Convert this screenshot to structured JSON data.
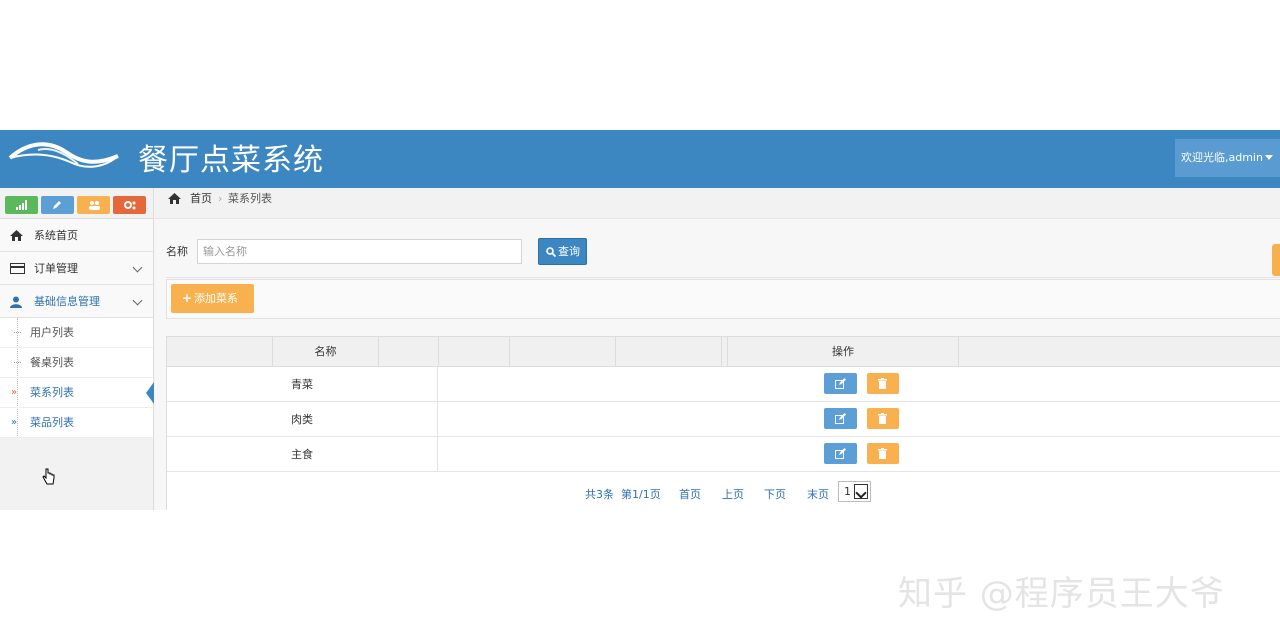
{
  "header": {
    "app_title": "餐厅点菜系统",
    "user_label": "欢迎光临,admin"
  },
  "shortcuts": [
    {
      "icon": "signal-icon",
      "color": "#5cb85c"
    },
    {
      "icon": "pencil-icon",
      "color": "#5b9fd6"
    },
    {
      "icon": "users-icon",
      "color": "#f8b14e"
    },
    {
      "icon": "cogs-icon",
      "color": "#e5683a"
    }
  ],
  "sidebar": {
    "items": [
      {
        "label": "系统首页",
        "icon": "home-icon"
      },
      {
        "label": "订单管理",
        "icon": "credit-card-icon"
      },
      {
        "label": "基础信息管理",
        "icon": "user-icon"
      }
    ],
    "subitems": [
      {
        "label": "用户列表"
      },
      {
        "label": "餐桌列表"
      },
      {
        "label": "菜系列表"
      },
      {
        "label": "菜品列表"
      }
    ]
  },
  "breadcrumb": {
    "home": "首页",
    "current": "菜系列表"
  },
  "search": {
    "label": "名称",
    "placeholder": "输入名称",
    "button": "查询"
  },
  "toolbar": {
    "add_label": "添加菜系"
  },
  "table": {
    "headers": {
      "name": "名称",
      "actions": "操作"
    },
    "rows": [
      {
        "name": "青菜"
      },
      {
        "name": "肉类"
      },
      {
        "name": "主食"
      }
    ]
  },
  "pager": {
    "total": "共3条",
    "page": "第1/1页",
    "first": "首页",
    "prev": "上页",
    "next": "下页",
    "last": "末页",
    "selected": "1"
  },
  "watermark": "知乎 @程序员王大爷",
  "colors": {
    "header": "#3c87c2",
    "primary": "#3c87c2",
    "warning": "#f8b14e",
    "info": "#5b9fd6"
  }
}
